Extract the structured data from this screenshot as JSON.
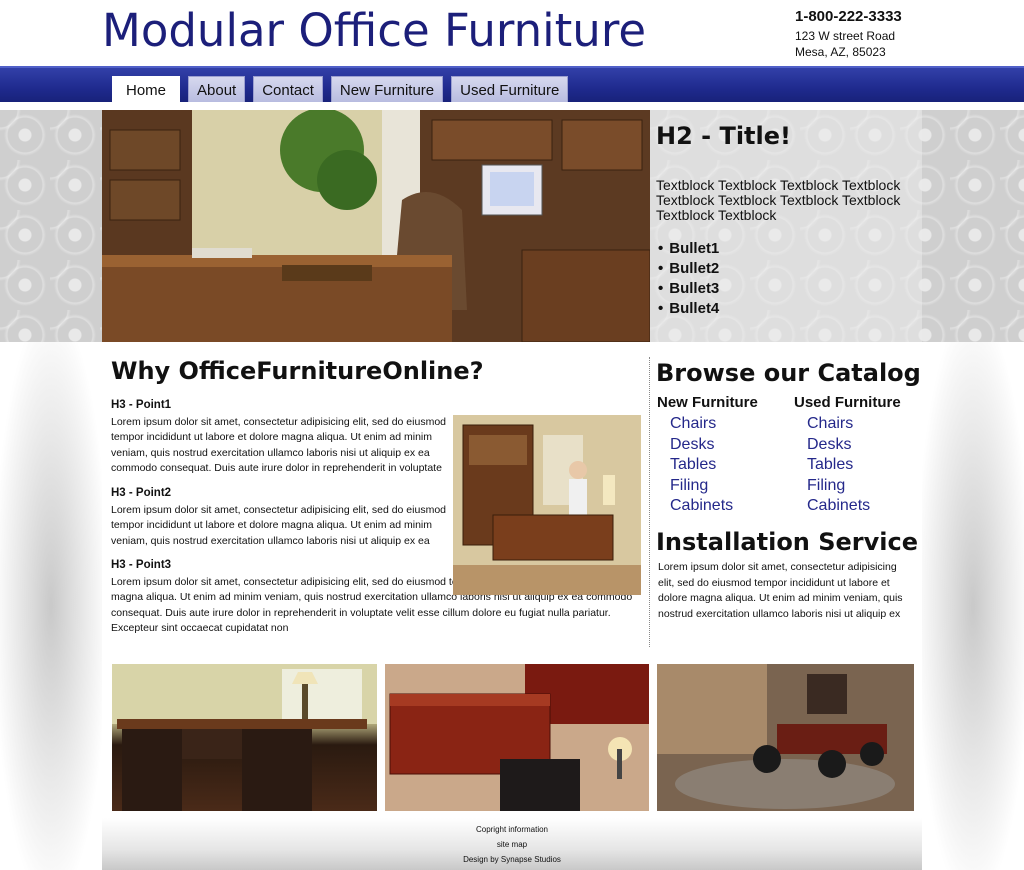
{
  "header": {
    "site_title": "Modular Office Furniture",
    "phone": "1-800-222-3333",
    "address_line1": "123 W street Road",
    "address_line2": "Mesa, AZ, 85023"
  },
  "nav": {
    "tabs": [
      {
        "label": "Home",
        "active": true
      },
      {
        "label": "About",
        "active": false
      },
      {
        "label": "Contact",
        "active": false
      },
      {
        "label": "New Furniture",
        "active": false
      },
      {
        "label": "Used Furniture",
        "active": false
      }
    ]
  },
  "hero": {
    "h2": "H2 - Title!",
    "text": "Textblock Textblock Textblock Textblock Textblock Textblock Textblock Textblock Textblock Textblock",
    "bullets": [
      "Bullet1",
      "Bullet2",
      "Bullet3",
      "Bullet4"
    ]
  },
  "why": {
    "title": "Why OfficeFurnitureOnline?",
    "points": [
      {
        "heading": "H3 - Point1",
        "body": "Lorem ipsum dolor sit amet, consectetur adipisicing elit, sed do eiusmod tempor incididunt ut labore et dolore magna aliqua. Ut enim ad minim veniam, quis nostrud exercitation ullamco laboris nisi ut aliquip ex ea commodo consequat. Duis aute irure dolor in reprehenderit in voluptate"
      },
      {
        "heading": "H3 - Point2",
        "body": "Lorem ipsum dolor sit amet, consectetur adipisicing elit, sed do eiusmod tempor incididunt ut labore et dolore magna aliqua. Ut enim ad minim veniam, quis nostrud exercitation ullamco laboris nisi ut aliquip ex ea"
      },
      {
        "heading": "H3 - Point3",
        "body": "Lorem ipsum dolor sit amet, consectetur adipisicing elit, sed do eiusmod tempor incididunt ut labore et dolore magna aliqua. Ut enim ad minim veniam, quis nostrud exercitation ullamco laboris nisi ut aliquip ex ea commodo consequat. Duis aute irure dolor in reprehenderit in voluptate velit esse cillum dolore eu fugiat nulla pariatur. Excepteur sint occaecat cupidatat non"
      }
    ]
  },
  "catalog": {
    "title": "Browse our Catalog",
    "new": {
      "heading": "New Furniture",
      "items": [
        "Chairs",
        "Desks",
        "Tables",
        "Filing",
        "Cabinets"
      ]
    },
    "used": {
      "heading": "Used Furniture",
      "items": [
        "Chairs",
        "Desks",
        "Tables",
        "Filing",
        "Cabinets"
      ]
    }
  },
  "installation": {
    "title": "Installation Service",
    "text": "Lorem ipsum dolor sit amet, consectetur adipisicing elit, sed do eiusmod tempor incididunt ut labore et dolore magna aliqua. Ut enim ad minim veniam, quis nostrud exercitation ullamco laboris nisi ut aliquip ex"
  },
  "footer": {
    "copyright": "Copright information",
    "sitemap": "site map",
    "credit": "Design by Synapse Studios"
  }
}
